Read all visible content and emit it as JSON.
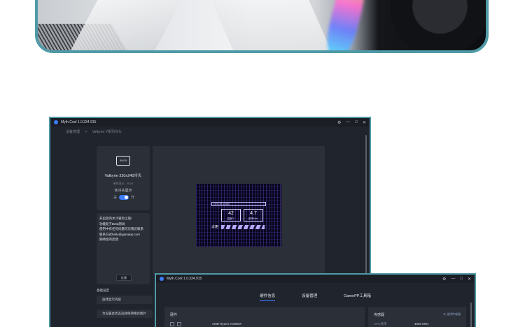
{
  "window1": {
    "title": "Myth.Cool  1.0.334.915",
    "breadcrumb": [
      "设备管理",
      ">",
      "Valkyrie V系列冷头"
    ],
    "device": {
      "icon_text": "00:00",
      "name": "Valkyrie 320x240冷头",
      "subtitle": "单色显示、RGB",
      "display_label": "水冷头显示",
      "toggle_off": "关",
      "toggle_on": "开"
    },
    "notice": {
      "lines": [
        "开启您的水冷冒险之旅!",
        "功能处于Beta测试",
        "使用中有任何问题可与我们联系",
        "联系方式hello@gamepp.com",
        "期待您的反馈"
      ],
      "feedback_button": "反馈"
    },
    "basic_settings_label": "基础设定",
    "settings_rows": [
      "旋转显示内容",
      "为设置此状态选择保持模式图片"
    ],
    "screen": {
      "cpu_label": "CPU",
      "cpu_usage": "35.13440",
      "temp_value": "42",
      "temp_label": "温度℃",
      "freq_value": "4.7",
      "freq_label": "频率MHz",
      "usage_label": "占用"
    }
  },
  "window2": {
    "title": "Myth.Cool  1.0.334.915",
    "tabs": [
      "硬件信息",
      "设备管理",
      "GamePP工具箱"
    ],
    "active_tab": 0,
    "left_panel": {
      "label": "硬件",
      "value": "AMD Ryzen 9 5900X"
    },
    "right_panel": {
      "label": "传感器",
      "more": "⚙ 选择传感器",
      "row_label": "CPU频率",
      "row_value": "4650 MHz"
    }
  },
  "colors": {
    "accent": "#3d7cff",
    "frame": "#4f9aa6",
    "window_bg": "#20242c",
    "card_bg": "#2a2f38"
  },
  "icons": [
    "settings-icon",
    "minimize-icon",
    "maximize-icon",
    "close-icon"
  ]
}
